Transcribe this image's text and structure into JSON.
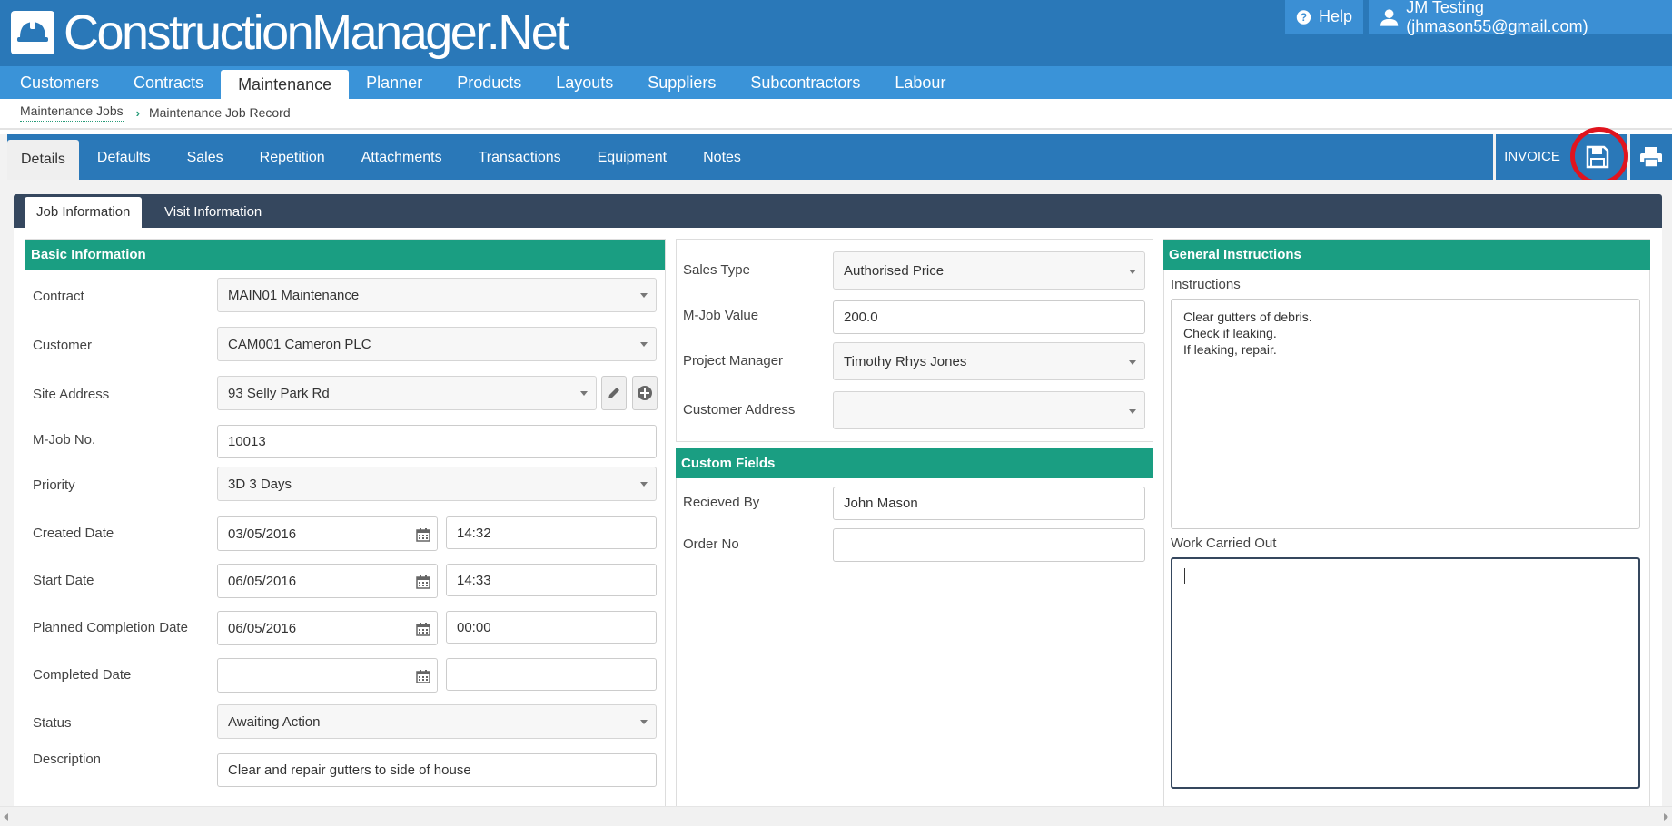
{
  "app": {
    "logo_text": "ConstructionManager.Net",
    "help_label": "Help",
    "user_label": "JM Testing (jhmason55@gmail.com)"
  },
  "main_nav": [
    {
      "label": "Customers"
    },
    {
      "label": "Contracts"
    },
    {
      "label": "Maintenance",
      "active": true
    },
    {
      "label": "Planner"
    },
    {
      "label": "Products"
    },
    {
      "label": "Layouts"
    },
    {
      "label": "Suppliers"
    },
    {
      "label": "Subcontractors"
    },
    {
      "label": "Labour"
    }
  ],
  "breadcrumb": {
    "parent": "Maintenance Jobs",
    "current": "Maintenance Job Record"
  },
  "sub_tabs": [
    {
      "label": "Details",
      "active": true
    },
    {
      "label": "Defaults"
    },
    {
      "label": "Sales"
    },
    {
      "label": "Repetition"
    },
    {
      "label": "Attachments"
    },
    {
      "label": "Transactions"
    },
    {
      "label": "Equipment"
    },
    {
      "label": "Notes"
    }
  ],
  "toolbar": {
    "invoice_label": "INVOICE"
  },
  "inner_tabs": {
    "job_information": "Job Information",
    "visit_information": "Visit Information"
  },
  "basic_info": {
    "title": "Basic Information",
    "contract_label": "Contract",
    "contract_value": "MAIN01 Maintenance",
    "customer_label": "Customer",
    "customer_value": "CAM001 Cameron PLC",
    "site_address_label": "Site Address",
    "site_address_value": "93 Selly Park Rd",
    "mjob_no_label": "M-Job No.",
    "mjob_no_value": "10013",
    "priority_label": "Priority",
    "priority_value": "3D 3 Days",
    "created_date_label": "Created Date",
    "created_date_value": "03/05/2016",
    "created_time_value": "14:32",
    "start_date_label": "Start Date",
    "start_date_value": "06/05/2016",
    "start_time_value": "14:33",
    "planned_completion_label": "Planned Completion Date",
    "planned_completion_value": "06/05/2016",
    "planned_completion_time": "00:00",
    "completed_date_label": "Completed Date",
    "completed_date_value": "",
    "completed_time_value": "",
    "status_label": "Status",
    "status_value": "Awaiting Action",
    "description_label": "Description",
    "description_value": "Clear and repair gutters to side of house"
  },
  "sales": {
    "sales_type_label": "Sales Type",
    "sales_type_value": "Authorised Price",
    "mjob_value_label": "M-Job Value",
    "mjob_value_value": "200.0",
    "project_manager_label": "Project Manager",
    "project_manager_value": "Timothy Rhys Jones",
    "customer_address_label": "Customer Address",
    "customer_address_value": ""
  },
  "custom_fields": {
    "title": "Custom Fields",
    "received_by_label": "Recieved By",
    "received_by_value": "John Mason",
    "order_no_label": "Order No",
    "order_no_value": ""
  },
  "general_instructions": {
    "title": "General Instructions",
    "instructions_label": "Instructions",
    "instructions_value": "Clear gutters of debris.\nCheck if leaking.\nIf leaking, repair.",
    "work_carried_out_label": "Work Carried Out",
    "work_carried_out_value": ""
  },
  "colors": {
    "header_blue": "#2a78b8",
    "nav_blue": "#3a93d8",
    "section_green": "#1a9e82",
    "panel_dark": "#35475e",
    "highlight_red": "#e0141e"
  }
}
